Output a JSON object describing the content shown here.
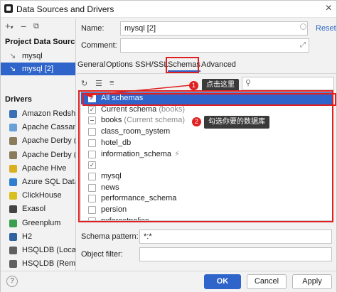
{
  "window": {
    "title": "Data Sources and Drivers"
  },
  "left": {
    "project_header": "Project Data Sources",
    "data_sources": [
      {
        "label": "mysql",
        "selected": false
      },
      {
        "label": "mysql [2]",
        "selected": true
      }
    ],
    "drivers_header": "Drivers",
    "drivers": [
      {
        "label": "Amazon Redshift",
        "color": "#3b6fb6"
      },
      {
        "label": "Apache Cassandra",
        "color": "#6aa0d8"
      },
      {
        "label": "Apache Derby (E",
        "color": "#8a7b5a"
      },
      {
        "label": "Apache Derby (R",
        "color": "#8a7b5a"
      },
      {
        "label": "Apache Hive",
        "color": "#d8b020"
      },
      {
        "label": "Azure SQL Datab",
        "color": "#2f7fd0"
      },
      {
        "label": "ClickHouse",
        "color": "#d8c020"
      },
      {
        "label": "Exasol",
        "color": "#444444"
      },
      {
        "label": "Greenplum",
        "color": "#3aa050"
      },
      {
        "label": "H2",
        "color": "#3060a0"
      },
      {
        "label": "HSQLDB (Local)",
        "color": "#606060"
      },
      {
        "label": "HSQLDB (Remot",
        "color": "#606060"
      }
    ]
  },
  "form": {
    "name_label": "Name:",
    "name_value": "mysql [2]",
    "reset_label": "Reset",
    "comment_label": "Comment:",
    "tabs": [
      {
        "label": "General",
        "active": false
      },
      {
        "label": "Options",
        "active": false
      },
      {
        "label": "SSH/SSL",
        "active": false
      },
      {
        "label": "Schemas",
        "active": true
      },
      {
        "label": "Advanced",
        "active": false
      }
    ],
    "schemas": [
      {
        "label": "All schemas",
        "hint": "",
        "state": "checked",
        "selected": true
      },
      {
        "label": "Current schema",
        "hint": "(books)",
        "state": "checked",
        "selected": false
      },
      {
        "label": "books",
        "hint": "(Current schema)",
        "state": "partial",
        "selected": false
      },
      {
        "label": "class_room_system",
        "hint": "",
        "state": "unchecked",
        "selected": false
      },
      {
        "label": "hotel_db",
        "hint": "",
        "state": "unchecked",
        "selected": false
      },
      {
        "label": "information_schema",
        "hint": "",
        "state": "unchecked",
        "selected": false,
        "bolt": true
      },
      {
        "label": "",
        "hint": "",
        "state": "checked",
        "selected": false
      },
      {
        "label": "mysql",
        "hint": "",
        "state": "unchecked",
        "selected": false
      },
      {
        "label": "news",
        "hint": "",
        "state": "unchecked",
        "selected": false
      },
      {
        "label": "performance_schema",
        "hint": "",
        "state": "unchecked",
        "selected": false
      },
      {
        "label": "persion",
        "hint": "",
        "state": "unchecked",
        "selected": false
      },
      {
        "label": "pxforestpolice",
        "hint": "",
        "state": "unchecked",
        "selected": false
      }
    ],
    "schema_pattern_label": "Schema pattern:",
    "schema_pattern_value": "*:*",
    "object_filter_label": "Object filter:"
  },
  "annotations": {
    "badge1": "1",
    "tip1": "点击这里",
    "badge2": "2",
    "tip2": "勾选你要的数据库"
  },
  "footer": {
    "help": "?",
    "ok": "OK",
    "cancel": "Cancel",
    "apply": "Apply"
  },
  "colors": {
    "accent": "#2f65ca",
    "annotation": "#e02020"
  }
}
